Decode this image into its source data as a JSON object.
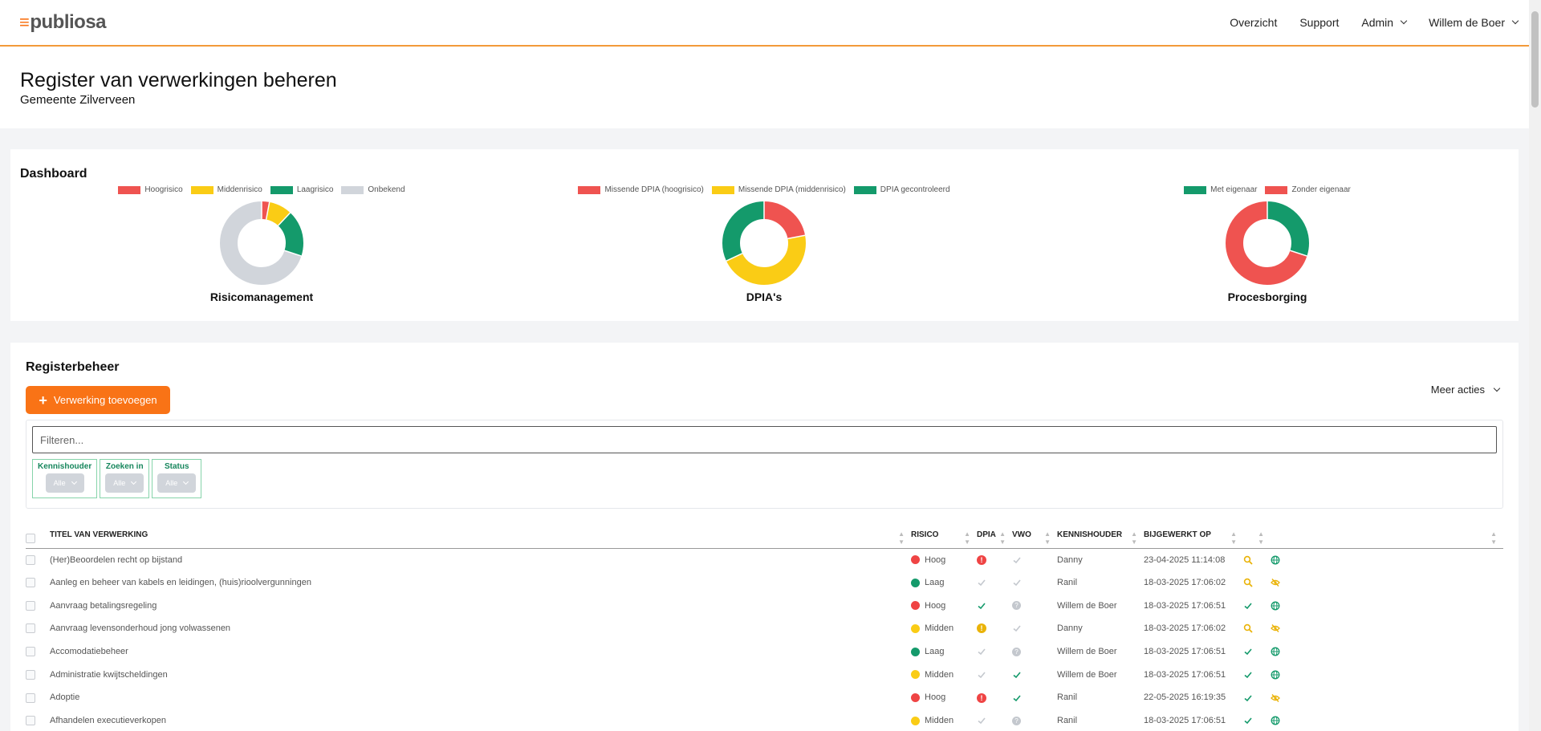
{
  "app": {
    "logo_text": "publiosa"
  },
  "nav": {
    "overzicht": "Overzicht",
    "support": "Support",
    "admin": "Admin",
    "user": "Willem de Boer"
  },
  "header": {
    "title": "Register van verwerkingen beheren",
    "subtitle": "Gemeente Zilverveen"
  },
  "dashboard": {
    "title": "Dashboard",
    "charts": [
      {
        "label": "Risicomanagement",
        "legend": [
          "Hoogrisico",
          "Middenrisico",
          "Laagrisico",
          "Onbekend"
        ],
        "colors": [
          "#ef5350",
          "#facc15",
          "#149a6b",
          "#d1d5db"
        ],
        "values": [
          3,
          9,
          18,
          70
        ]
      },
      {
        "label": "DPIA's",
        "legend": [
          "Missende DPIA (hoogrisico)",
          "Missende DPIA (middenrisico)",
          "DPIA gecontroleerd"
        ],
        "colors": [
          "#ef5350",
          "#facc15",
          "#149a6b"
        ],
        "values": [
          22,
          46,
          32
        ]
      },
      {
        "label": "Procesborging",
        "legend": [
          "Met eigenaar",
          "Zonder eigenaar"
        ],
        "colors": [
          "#149a6b",
          "#ef5350"
        ],
        "values": [
          30,
          70
        ]
      }
    ]
  },
  "register": {
    "title": "Registerbeheer",
    "add_label": "Verwerking toevoegen",
    "more_label": "Meer acties",
    "filter_placeholder": "Filteren...",
    "facets": [
      {
        "label": "Kennishouder",
        "value": "Alle"
      },
      {
        "label": "Zoeken in",
        "value": "Alle"
      },
      {
        "label": "Status",
        "value": "Alle"
      }
    ],
    "columns": [
      "TITEL VAN VERWERKING",
      "RISICO",
      "DPIA",
      "VWO",
      "KENNISHOUDER",
      "BIJGEWERKT OP"
    ],
    "risk_colors": {
      "Hoog": "#ef4444",
      "Laag": "#149a6b",
      "Midden": "#facc15"
    },
    "rows": [
      {
        "title": "(Her)Beoordelen recht op bijstand",
        "risico": "Hoog",
        "dpia": "alert-red",
        "vwo": "check-grey",
        "kennishouder": "Danny",
        "datum": "23-04-2025 11:14:08",
        "a1": "search-icon",
        "a2": "globe-icon"
      },
      {
        "title": "Aanleg en beheer van kabels en leidingen, (huis)rioolvergunningen",
        "risico": "Laag",
        "dpia": "check-grey",
        "vwo": "check-grey",
        "kennishouder": "Ranil",
        "datum": "18-03-2025 17:06:02",
        "a1": "search-icon",
        "a2": "eye-slash-icon"
      },
      {
        "title": "Aanvraag betalingsregeling",
        "risico": "Hoog",
        "dpia": "check-green",
        "vwo": "question-grey",
        "kennishouder": "Willem de Boer",
        "datum": "18-03-2025 17:06:51",
        "a1": "check-icon",
        "a2": "globe-icon"
      },
      {
        "title": "Aanvraag levensonderhoud jong volwassenen",
        "risico": "Midden",
        "dpia": "alert-yellow",
        "vwo": "check-grey",
        "kennishouder": "Danny",
        "datum": "18-03-2025 17:06:02",
        "a1": "search-icon",
        "a2": "eye-slash-icon"
      },
      {
        "title": "Accomodatiebeheer",
        "risico": "Laag",
        "dpia": "check-grey",
        "vwo": "question-grey",
        "kennishouder": "Willem de Boer",
        "datum": "18-03-2025 17:06:51",
        "a1": "check-icon",
        "a2": "globe-icon"
      },
      {
        "title": "Administratie kwijtscheldingen",
        "risico": "Midden",
        "dpia": "check-grey",
        "vwo": "check-green",
        "kennishouder": "Willem de Boer",
        "datum": "18-03-2025 17:06:51",
        "a1": "check-icon",
        "a2": "globe-icon"
      },
      {
        "title": "Adoptie",
        "risico": "Hoog",
        "dpia": "alert-red",
        "vwo": "check-green",
        "kennishouder": "Ranil",
        "datum": "22-05-2025 16:19:35",
        "a1": "check-icon",
        "a2": "eye-slash-icon"
      },
      {
        "title": "Afhandelen executieverkopen",
        "risico": "Midden",
        "dpia": "check-grey",
        "vwo": "question-grey",
        "kennishouder": "Ranil",
        "datum": "18-03-2025 17:06:51",
        "a1": "check-icon",
        "a2": "globe-icon"
      }
    ]
  }
}
